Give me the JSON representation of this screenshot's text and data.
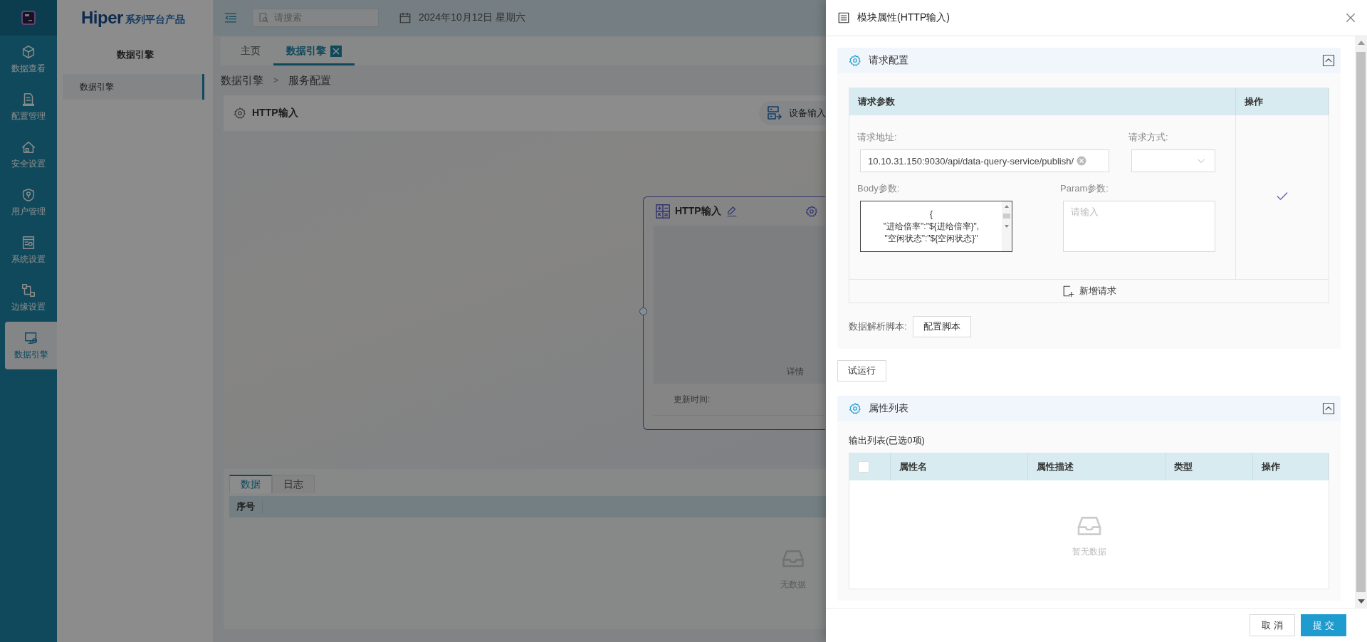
{
  "nav_rail": {
    "items": [
      {
        "label": "数据查看",
        "selected": false
      },
      {
        "label": "配置管理",
        "selected": false
      },
      {
        "label": "安全设置",
        "selected": false
      },
      {
        "label": "用户管理",
        "selected": false
      },
      {
        "label": "系统设置",
        "selected": false
      },
      {
        "label": "边缘设置",
        "selected": false
      },
      {
        "label": "数据引擎",
        "selected": true
      }
    ]
  },
  "brand": {
    "name": "Hiper",
    "tagline": "系列平台产品"
  },
  "side_menu": {
    "title": "数据引擎",
    "items": [
      {
        "label": "数据引擎",
        "selected": true
      }
    ]
  },
  "top_bar": {
    "search": {
      "placeholder": "请搜索"
    },
    "date": "2024年10月12日 星期六"
  },
  "tabs": [
    {
      "label": "主页",
      "selected": false,
      "closable": false
    },
    {
      "label": "数据引擎",
      "selected": true,
      "closable": true
    }
  ],
  "breadcrumb": {
    "items": [
      "数据引擎",
      "服务配置"
    ],
    "separator": ">"
  },
  "panel": {
    "title": "HTTP输入",
    "action": "设备输入"
  },
  "node": {
    "title": "HTTP输入",
    "detail": "详情",
    "update_label": "更新时间:"
  },
  "bottom_panel": {
    "tabs": [
      {
        "label": "数据",
        "selected": true
      },
      {
        "label": "日志",
        "selected": false
      }
    ],
    "columns": [
      "序号"
    ],
    "empty_text": "无数据"
  },
  "drawer": {
    "title": "模块属性(HTTP输入)",
    "request_section": {
      "title": "请求配置",
      "expanded": true,
      "columns": [
        "请求参数",
        "操作"
      ],
      "url_label": "请求地址:",
      "url": "10.10.31.150:9030/api/data-query-service/publish/",
      "method_label": "请求方式:",
      "body_label": "Body参数:",
      "body_lines": [
        "{",
        "\"进给倍率\":\"${进给倍率}\",",
        "\"空闲状态\":\"${空闲状态}\""
      ],
      "param_label": "Param参数:",
      "param_placeholder": "请输入",
      "add_request": "新增请求",
      "script_label": "数据解析脚本:",
      "script_button": "配置脚本"
    },
    "test_run": "试运行",
    "attribute_section": {
      "title": "属性列表",
      "expanded": true,
      "summary": "输出列表(已选0项)",
      "select_all": {
        "checked": false
      },
      "columns": [
        "属性名",
        "属性描述",
        "类型",
        "操作"
      ],
      "empty_text": "暂无数据"
    },
    "footer": {
      "buttons": [
        {
          "label": "取 消",
          "kind": "default"
        },
        {
          "label": "提 交",
          "kind": "primary"
        }
      ]
    }
  }
}
